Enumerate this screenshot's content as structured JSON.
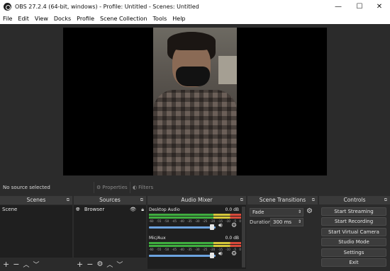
{
  "window": {
    "title": "OBS 27.2.4 (64-bit, windows) - Profile: Untitled - Scenes: Untitled"
  },
  "menu": [
    "File",
    "Edit",
    "View",
    "Docks",
    "Profile",
    "Scene Collection",
    "Tools",
    "Help"
  ],
  "status": {
    "no_source": "No source selected",
    "properties": "Properties",
    "filters": "Filters"
  },
  "scenes": {
    "title": "Scenes",
    "items": [
      "Scene"
    ]
  },
  "sources": {
    "title": "Sources",
    "items": [
      "Browser"
    ]
  },
  "mixer": {
    "title": "Audio Mixer",
    "channels": [
      {
        "name": "Desktop Audio",
        "level": "0.0 dB"
      },
      {
        "name": "Mic/Aux",
        "level": "0.0 dB"
      }
    ],
    "scale": [
      "-60",
      "-55",
      "-50",
      "-45",
      "-40",
      "-35",
      "-30",
      "-25",
      "-20",
      "-15",
      "-10",
      "-5",
      "0"
    ]
  },
  "transitions": {
    "title": "Scene Transitions",
    "selected": "Fade",
    "duration_label": "Duration",
    "duration_value": "300 ms"
  },
  "controls": {
    "title": "Controls",
    "buttons": [
      "Start Streaming",
      "Start Recording",
      "Start Virtual Camera",
      "Studio Mode",
      "Settings",
      "Exit"
    ]
  },
  "colors": {
    "meter_green": "#3fae3f",
    "meter_yellow": "#d6c83a",
    "meter_red": "#d94a3a",
    "slider_blue": "#6ca3e0"
  }
}
